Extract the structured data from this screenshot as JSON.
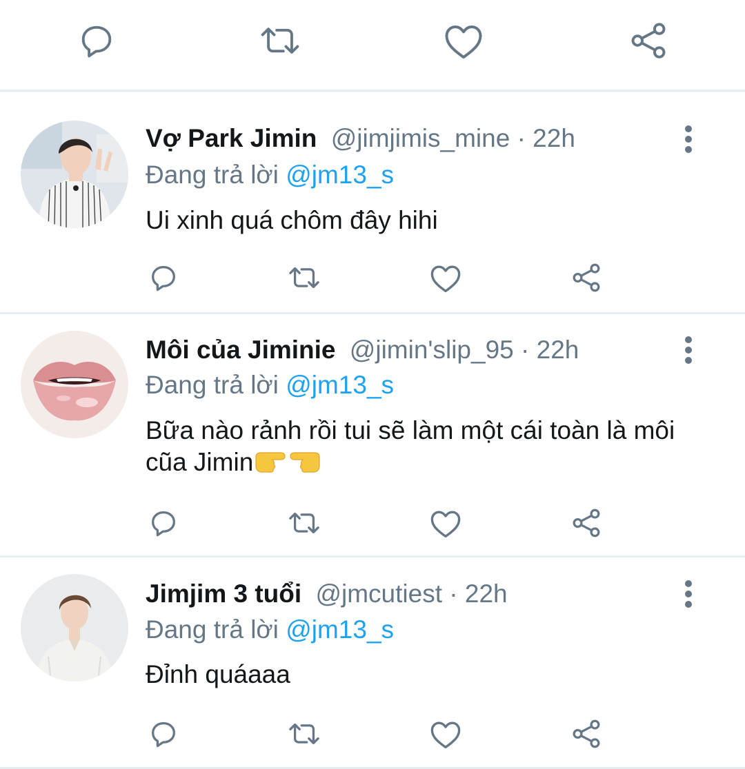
{
  "colors": {
    "background": "#ffffff",
    "text_primary": "#14171a",
    "text_secondary": "#657786",
    "mention": "#1da1f2",
    "divider": "#e6ecf0"
  },
  "top_actions": {
    "icons": [
      "reply-icon",
      "retweet-icon",
      "like-icon",
      "share-icon"
    ]
  },
  "tweets": [
    {
      "name": "Vợ Park Jimin",
      "handle": "@jimjimis_mine",
      "dot": "·",
      "time": "22h",
      "reply_prefix": "Đang trả lời",
      "reply_to": "@jm13_s",
      "text": "Ui xinh quá chôm đây hihi",
      "avatar": "profile-photo-striped-shirt"
    },
    {
      "name": "Môi của Jiminie",
      "handle": "@jimin'slip_95",
      "dot": "·",
      "time": "22h",
      "reply_prefix": "Đang trả lời",
      "reply_to": "@jm13_s",
      "text": "Bữa nào rảnh rồi tui sẽ làm một cái toàn là môi cũa Jimin",
      "emojis": [
        "backhand-index-pointing-right",
        "backhand-index-pointing-left"
      ],
      "avatar": "profile-photo-lips"
    },
    {
      "name": "Jimjim 3 tuổi",
      "handle": "@jmcutiest",
      "dot": "·",
      "time": "22h",
      "reply_prefix": "Đang trả lời",
      "reply_to": "@jm13_s",
      "text": "Đỉnh quáaaa",
      "avatar": "profile-photo-white-shirt"
    }
  ]
}
